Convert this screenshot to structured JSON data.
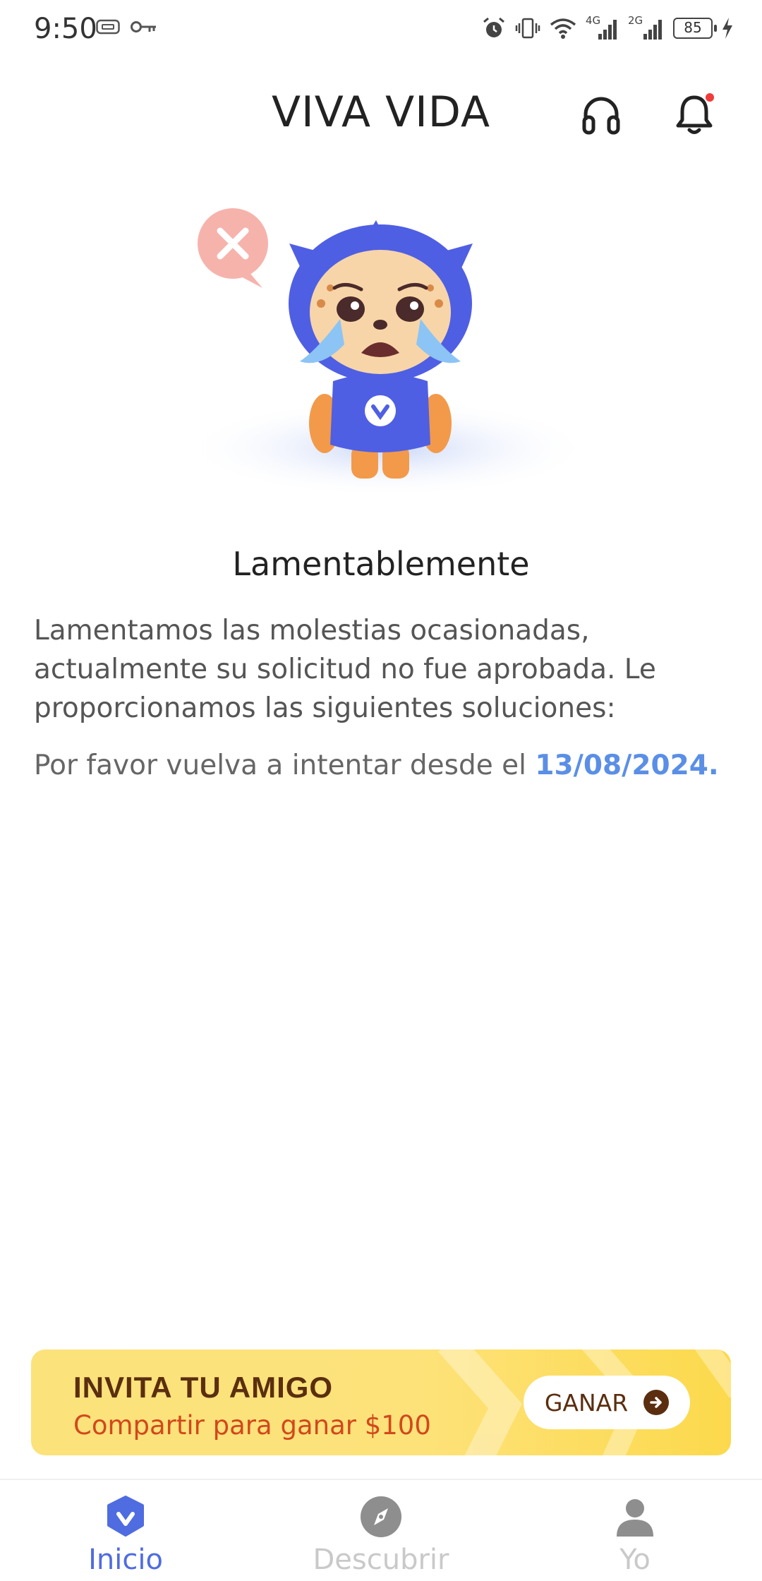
{
  "status_bar": {
    "time": "9:50",
    "network_4g": "4G",
    "network_2g": "2G",
    "battery": "85",
    "icons": [
      "sim-card-icon",
      "key-icon",
      "alarm-icon",
      "vibrate-icon",
      "wifi-icon",
      "signal-icon",
      "charging-icon"
    ]
  },
  "header": {
    "title": "VIVA VIDA",
    "icons": [
      "headset-icon",
      "bell-icon"
    ],
    "notification_dot_color": "#f03b3b"
  },
  "result": {
    "title": "Lamentablemente",
    "description": "Lamentamos las molestias ocasionadas, actualmente su solicitud no fue aprobada. Le proporcionamos las siguientes soluciones:",
    "retry_prefix": "Por favor vuelva a intentar desde el ",
    "retry_date": "13/08/2024."
  },
  "invite_banner": {
    "title": "INVITA TU AMIGO",
    "subtitle": "Compartir para ganar $100",
    "button_label": "GANAR",
    "colors": {
      "title": "#5b2e10",
      "subtitle": "#d2481c",
      "background": "#fde27a"
    }
  },
  "bottom_nav": {
    "items": [
      {
        "label": "Inicio",
        "icon": "home-logo-icon",
        "active": true
      },
      {
        "label": "Descubrir",
        "icon": "compass-icon",
        "active": false
      },
      {
        "label": "Yo",
        "icon": "person-icon",
        "active": false
      }
    ],
    "active_color": "#4f6ce0",
    "inactive_color": "#c9c9c9"
  },
  "accent_color": "#5b8fe6"
}
